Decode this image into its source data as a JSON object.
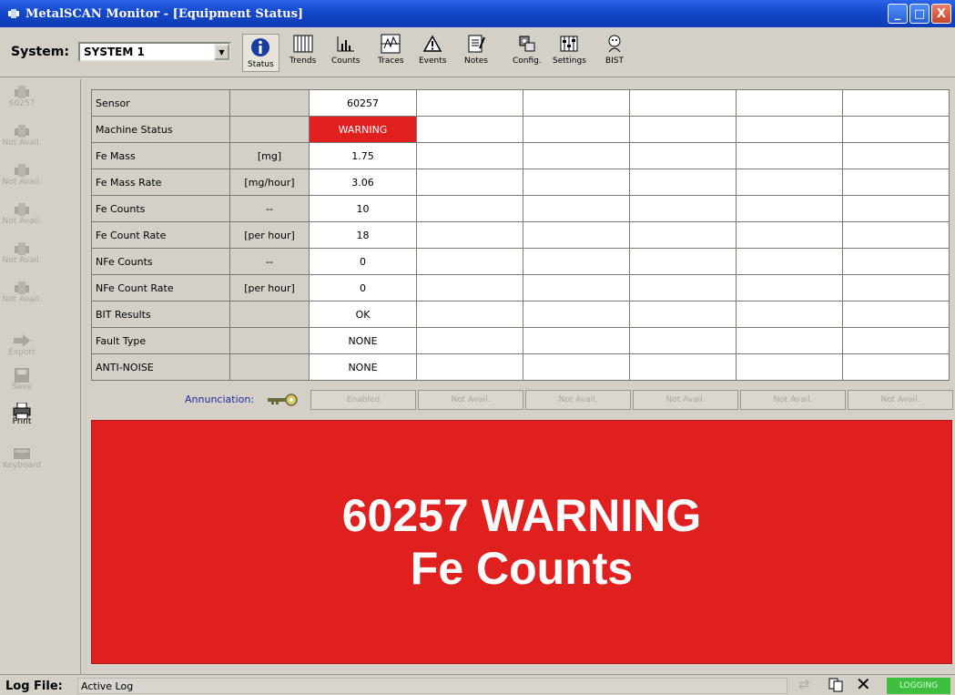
{
  "window": {
    "title": "MetalSCAN Monitor - [Equipment Status]",
    "controls": {
      "minimize": "_",
      "maximize": "□",
      "close": "X"
    }
  },
  "toolbar": {
    "system_label": "System:",
    "system_value": "SYSTEM 1",
    "buttons": [
      {
        "label": "Status",
        "icon": "info-icon",
        "selected": true
      },
      {
        "label": "Trends",
        "icon": "trends-icon"
      },
      {
        "label": "Counts",
        "icon": "counts-icon"
      },
      {
        "label": "Traces",
        "icon": "traces-icon"
      },
      {
        "label": "Events",
        "icon": "warning-triangle-icon"
      },
      {
        "label": "Notes",
        "icon": "notes-icon"
      },
      {
        "label": "Config.",
        "icon": "config-icon"
      },
      {
        "label": "Settings",
        "icon": "settings-icon"
      },
      {
        "label": "BIST",
        "icon": "bist-icon"
      }
    ]
  },
  "sidebar": {
    "items": [
      {
        "label": "60257",
        "icon": "sensor-icon"
      },
      {
        "label": "Not Avail.",
        "icon": "sensor-icon"
      },
      {
        "label": "Not Avail.",
        "icon": "sensor-icon"
      },
      {
        "label": "Not Avail.",
        "icon": "sensor-icon"
      },
      {
        "label": "Not Avail.",
        "icon": "sensor-icon"
      },
      {
        "label": "Not Avail.",
        "icon": "sensor-icon"
      },
      {
        "label": "Export",
        "icon": "arrow-right-icon"
      },
      {
        "label": "Save",
        "icon": "save-icon"
      },
      {
        "label": "Print",
        "icon": "printer-icon"
      },
      {
        "label": "Keyboard",
        "icon": "keyboard-icon"
      }
    ]
  },
  "status_table": {
    "rows": [
      {
        "name": "Sensor",
        "unit": "",
        "value": "60257"
      },
      {
        "name": "Machine Status",
        "unit": "",
        "value": "WARNING"
      },
      {
        "name": "Fe Mass",
        "unit": "[mg]",
        "value": "1.75"
      },
      {
        "name": "Fe Mass Rate",
        "unit": "[mg/hour]",
        "value": "3.06"
      },
      {
        "name": "Fe Counts",
        "unit": "--",
        "value": "10"
      },
      {
        "name": "Fe Count Rate",
        "unit": "[per hour]",
        "value": "18"
      },
      {
        "name": "NFe Counts",
        "unit": "--",
        "value": "0"
      },
      {
        "name": "NFe Count Rate",
        "unit": "[per hour]",
        "value": "0"
      },
      {
        "name": "BIT Results",
        "unit": "",
        "value": "OK"
      },
      {
        "name": "Fault Type",
        "unit": "",
        "value": "NONE"
      },
      {
        "name": "ANTI-NOISE",
        "unit": "",
        "value": "NONE"
      }
    ]
  },
  "annunciation": {
    "label": "Annunciation:",
    "buttons": [
      "Enabled",
      "Not Avail.",
      "Not Avail.",
      "Not Avail.",
      "Not Avail.",
      "Not Avail."
    ]
  },
  "alarm": {
    "line1": "60257 WARNING",
    "line2": "Fe Counts"
  },
  "statusbar": {
    "log_label": "Log File:",
    "log_value": "Active Log",
    "logging": "LOGGING"
  },
  "colors": {
    "warning_red": "#e01f1f",
    "logging_green": "#3fbf3f",
    "titlebar_blue": "#1447c9"
  }
}
